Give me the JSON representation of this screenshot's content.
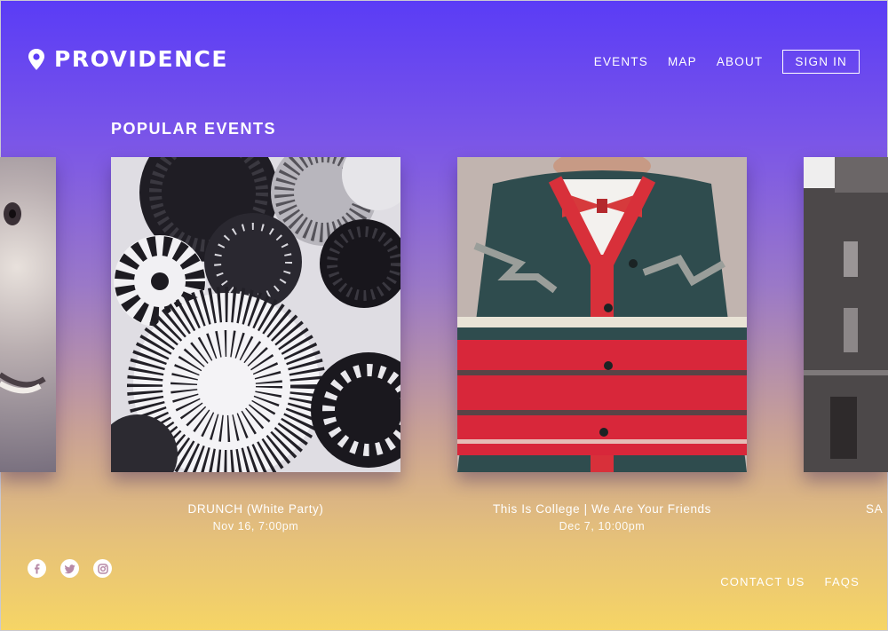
{
  "brand": {
    "name": "PROVIDENCE"
  },
  "nav": {
    "events": "EVENTS",
    "map": "MAP",
    "about": "ABOUT",
    "sign_in": "SIGN IN"
  },
  "section": {
    "title": "POPULAR EVENTS"
  },
  "events": [
    {
      "name": "DRUNCH (White Party)",
      "date": "Nov 16, 7:00pm"
    },
    {
      "name": "This Is College | We Are Your Friends",
      "date": "Dec 7, 10:00pm"
    },
    {
      "name": "SA"
    }
  ],
  "footer": {
    "contact": "CONTACT US",
    "faqs": "FAQS"
  },
  "social": [
    "facebook-icon",
    "twitter-icon",
    "instagram-icon"
  ],
  "colors": {
    "gradient_top": "#5a3cf6",
    "gradient_bottom": "#f6d565"
  }
}
